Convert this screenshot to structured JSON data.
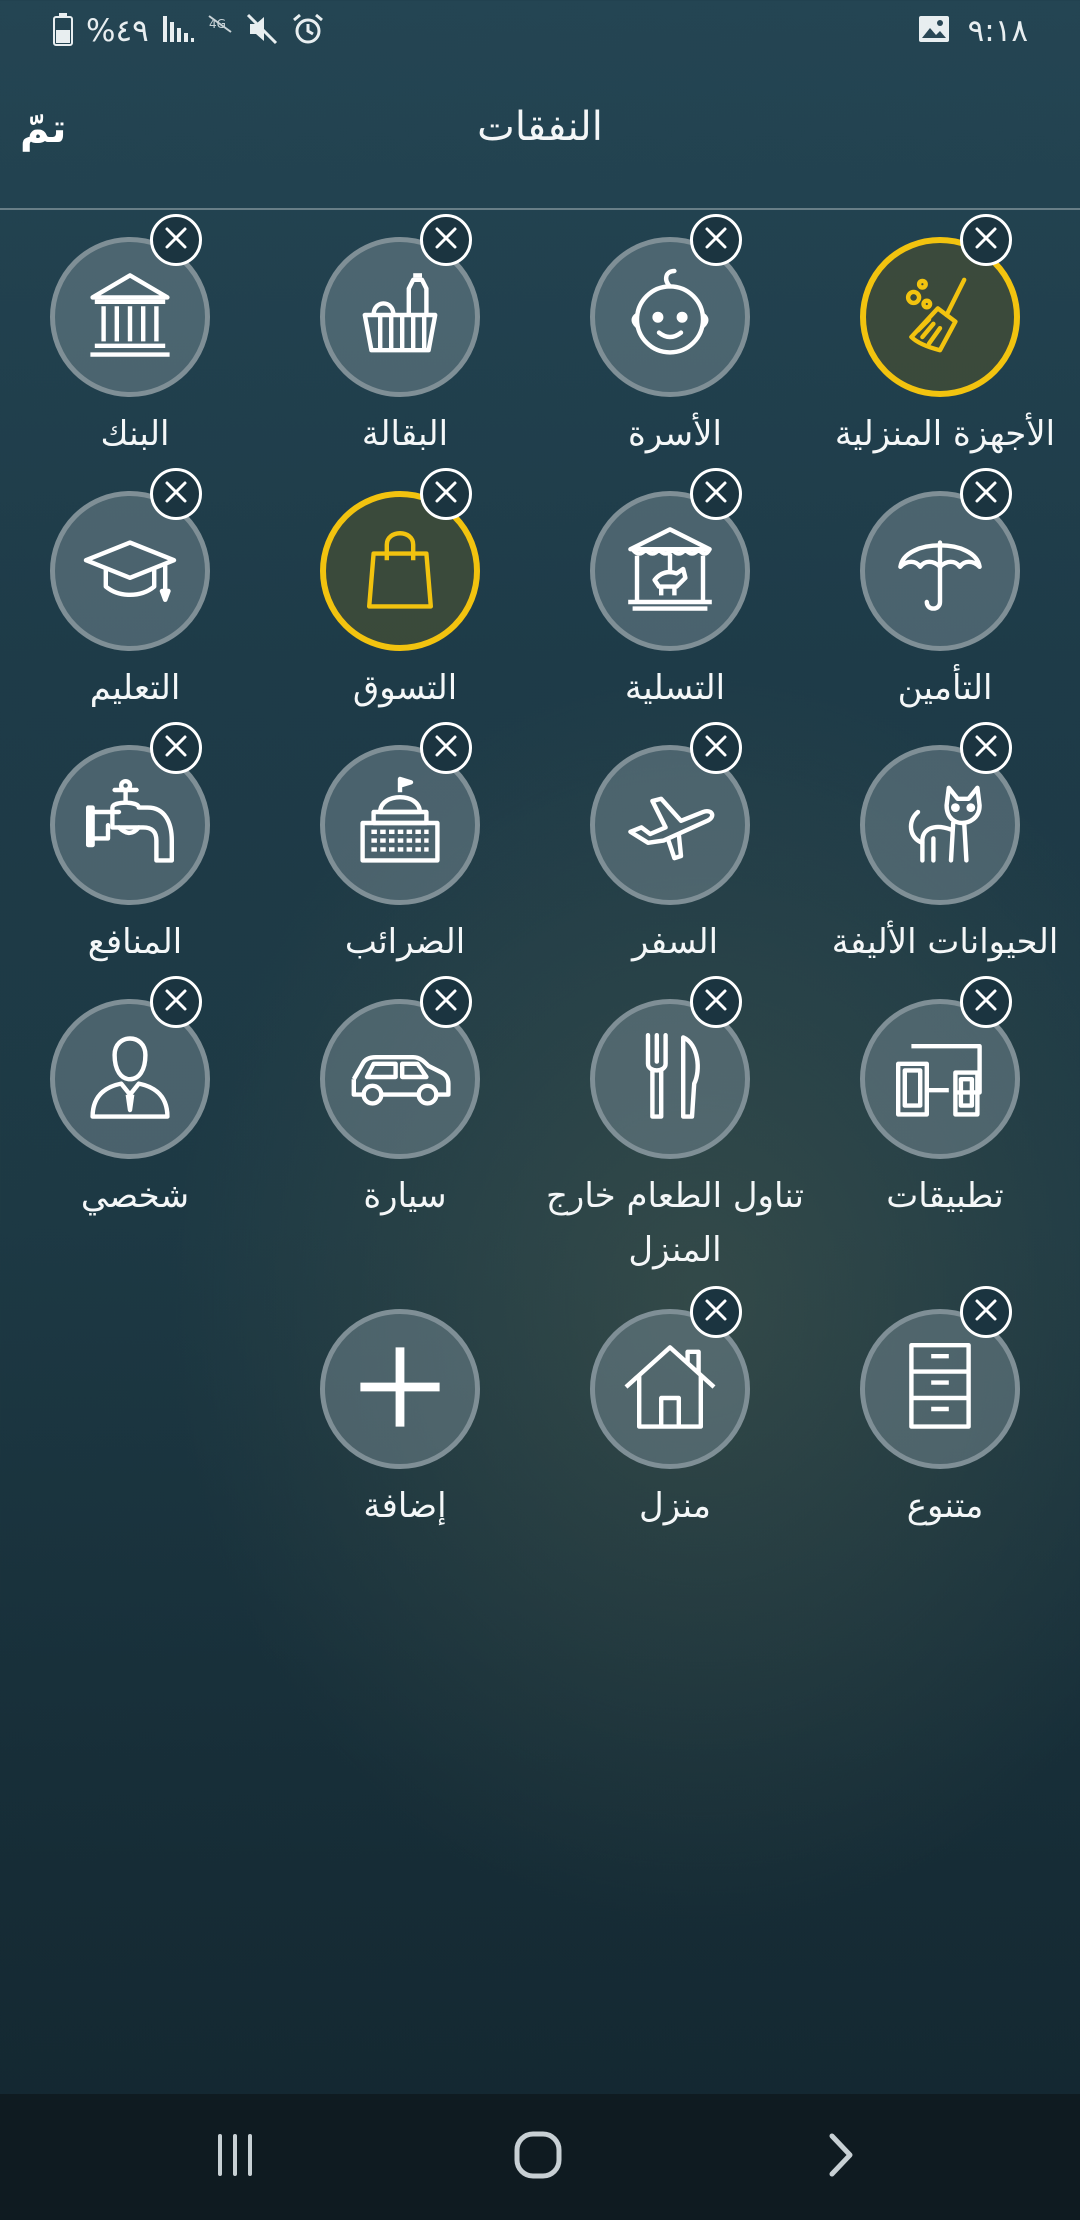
{
  "status_bar": {
    "time": "٩:١٨",
    "battery": "%٤٩",
    "icons": [
      "gallery-icon",
      "battery-icon",
      "signal-icon",
      "no-data-icon",
      "mute-icon",
      "alarm-icon"
    ]
  },
  "header": {
    "title": "النفقات",
    "done_label": "تمّ"
  },
  "categories": [
    {
      "label": "الأجهزة المنزلية",
      "icon": "broom-icon",
      "selected": true
    },
    {
      "label": "الأسرة",
      "icon": "baby-icon",
      "selected": false
    },
    {
      "label": "البقالة",
      "icon": "grocery-basket-icon",
      "selected": false
    },
    {
      "label": "البنك",
      "icon": "bank-icon",
      "selected": false
    },
    {
      "label": "التأمين",
      "icon": "umbrella-icon",
      "selected": false
    },
    {
      "label": "التسلية",
      "icon": "carousel-icon",
      "selected": false
    },
    {
      "label": "التسوق",
      "icon": "shopping-bag-icon",
      "selected": true
    },
    {
      "label": "التعليم",
      "icon": "graduation-cap-icon",
      "selected": false
    },
    {
      "label": "الحيوانات الأليفة",
      "icon": "cat-icon",
      "selected": false
    },
    {
      "label": "السفر",
      "icon": "airplane-icon",
      "selected": false
    },
    {
      "label": "الضرائب",
      "icon": "government-building-icon",
      "selected": false
    },
    {
      "label": "المنافع",
      "icon": "water-tap-icon",
      "selected": false
    },
    {
      "label": "تطبيقات",
      "icon": "devices-icon",
      "selected": false
    },
    {
      "label": "تناول الطعام خارج المنزل",
      "icon": "fork-knife-icon",
      "selected": false
    },
    {
      "label": "سيارة",
      "icon": "car-icon",
      "selected": false
    },
    {
      "label": "شخصي",
      "icon": "person-icon",
      "selected": false
    },
    {
      "label": "متنوع",
      "icon": "cabinet-icon",
      "selected": false
    },
    {
      "label": "منزل",
      "icon": "house-icon",
      "selected": false
    }
  ],
  "add_button": {
    "label": "إضافة",
    "icon": "plus-icon"
  },
  "nav_bar": {
    "icons": [
      "recent-apps-icon",
      "home-icon",
      "back-icon"
    ]
  }
}
